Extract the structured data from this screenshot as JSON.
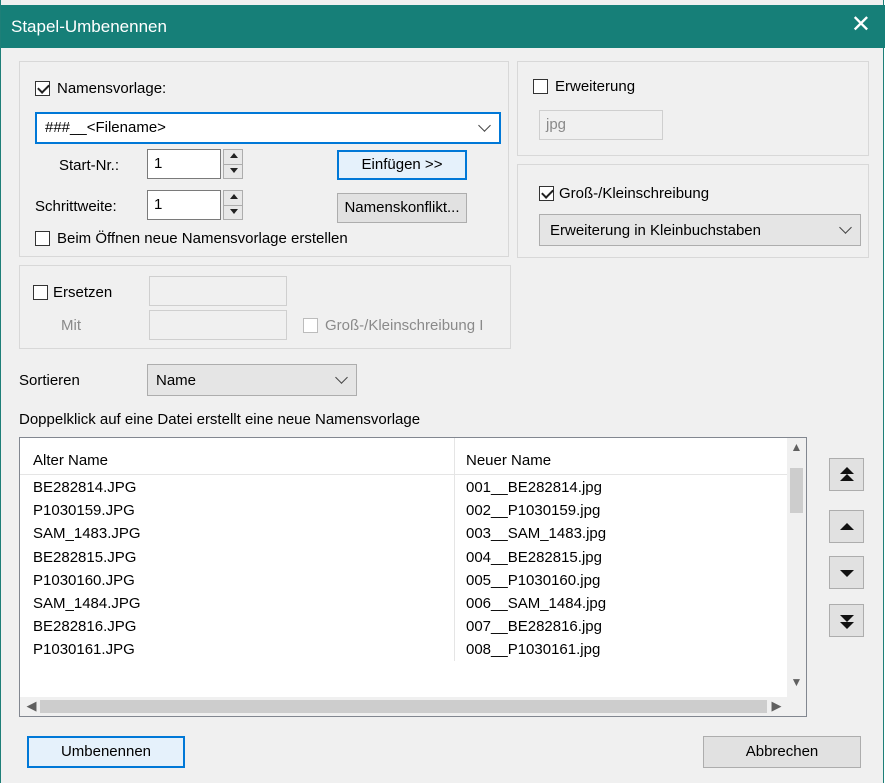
{
  "window": {
    "title": "Stapel-Umbenennen",
    "close_glyph": "✕"
  },
  "template": {
    "checkbox_label": "Namensvorlage:",
    "checked": true,
    "value": "###__<Filename>",
    "start_label": "Start-Nr.:",
    "start_value": "1",
    "step_label": "Schrittweite:",
    "step_value": "1",
    "insert_button": "Einfügen >>",
    "conflict_button": "Namenskonflikt...",
    "new_template_label": "Beim Öffnen neue Namensvorlage erstellen",
    "new_template_checked": false
  },
  "extension": {
    "checkbox_label": "Erweiterung",
    "checked": false,
    "value": "jpg"
  },
  "case": {
    "checkbox_label": "Groß-/Kleinschreibung",
    "checked": true,
    "selected": "Erweiterung in Kleinbuchstaben"
  },
  "replace": {
    "checkbox_label": "Ersetzen",
    "checked": false,
    "with_label": "Mit",
    "case_label": "Groß-/Kleinschreibung I",
    "case_checked": false
  },
  "sort": {
    "label": "Sortieren",
    "selected": "Name"
  },
  "hint": "Doppelklick auf eine Datei erstellt eine neue Namensvorlage",
  "files": {
    "columns": [
      "Alter Name",
      "Neuer Name"
    ],
    "rows": [
      [
        "BE282814.JPG",
        "001__BE282814.jpg"
      ],
      [
        "P1030159.JPG",
        "002__P1030159.jpg"
      ],
      [
        "SAM_1483.JPG",
        "003__SAM_1483.jpg"
      ],
      [
        "BE282815.JPG",
        "004__BE282815.jpg"
      ],
      [
        "P1030160.JPG",
        "005__P1030160.jpg"
      ],
      [
        "SAM_1484.JPG",
        "006__SAM_1484.jpg"
      ],
      [
        "BE282816.JPG",
        "007__BE282816.jpg"
      ],
      [
        "P1030161.JPG",
        "008__P1030161.jpg"
      ]
    ]
  },
  "buttons": {
    "rename": "Umbenennen",
    "cancel": "Abbrechen"
  },
  "colors": {
    "titlebar": "#167f78",
    "focus": "#0078d7"
  }
}
